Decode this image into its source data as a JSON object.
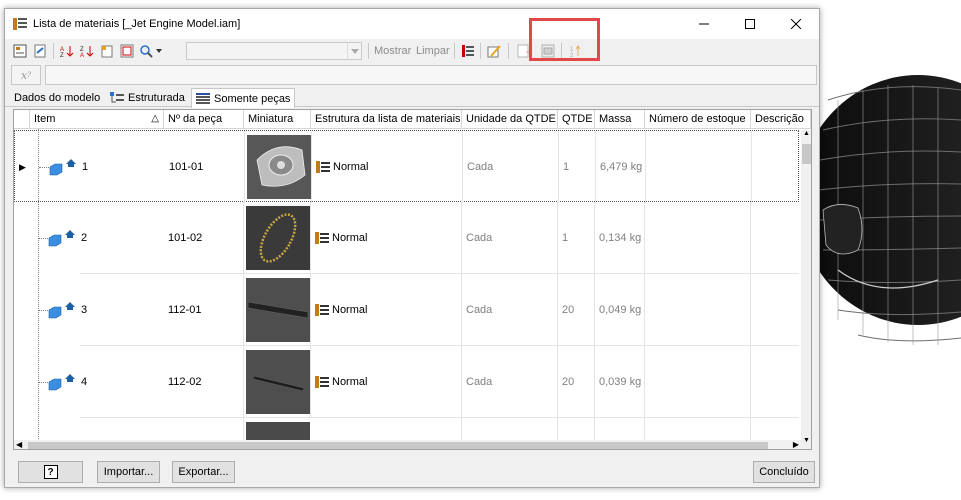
{
  "window": {
    "title": "Lista de materiais [_Jet Engine Model.iam]",
    "title_icon": "bom-icon"
  },
  "toolbar": {
    "filter_value": "",
    "show_label": "Mostrar",
    "clear_label": "Limpar",
    "icons": [
      "bom-view-icon",
      "export-icon",
      "sort-ascending-icon",
      "sort-descending-icon",
      "renumber-icon",
      "item-settings-icon",
      "find-icon",
      "filter-icon",
      "column-chooser-icon",
      "edit-property-icon",
      "add-custom-icon",
      "refresh-thumbnail-icon",
      "sort-items-icon"
    ]
  },
  "formula": {
    "fx_label": "x",
    "value": ""
  },
  "tabs": [
    {
      "label": "Dados do modelo",
      "active": false
    },
    {
      "label": "Estruturada",
      "active": false
    },
    {
      "label": "Somente peças",
      "active": true
    }
  ],
  "grid": {
    "columns": [
      "Item",
      "Nº da peça",
      "Miniatura",
      "Estrutura da lista de materiais",
      "Unidade da QTDE",
      "QTDE",
      "Massa",
      "Número de estoque",
      "Descrição"
    ],
    "sort_indicator": "△",
    "rows": [
      {
        "item": "1",
        "part_no": "101-01",
        "thumbnail": "engine-housing-thumbnail",
        "structure": "Normal",
        "unit": "Cada",
        "qty": "1",
        "mass": "6,479 kg",
        "stock": "",
        "description": "",
        "selected": true
      },
      {
        "item": "2",
        "part_no": "101-02",
        "thumbnail": "ring-thumbnail",
        "structure": "Normal",
        "unit": "Cada",
        "qty": "1",
        "mass": "0,134 kg",
        "stock": "",
        "description": "",
        "selected": false
      },
      {
        "item": "3",
        "part_no": "112-01",
        "thumbnail": "blade-thumbnail",
        "structure": "Normal",
        "unit": "Cada",
        "qty": "20",
        "mass": "0,049 kg",
        "stock": "",
        "description": "",
        "selected": false
      },
      {
        "item": "4",
        "part_no": "112-02",
        "thumbnail": "pin-thumbnail",
        "structure": "Normal",
        "unit": "Cada",
        "qty": "20",
        "mass": "0,039 kg",
        "stock": "",
        "description": "",
        "selected": false
      }
    ]
  },
  "buttons": {
    "help": "?",
    "import": "Importar...",
    "export": "Exportar...",
    "done": "Concluído"
  },
  "colors": {
    "highlight": "#e2484a",
    "part_icon": "#3b8fe0"
  }
}
